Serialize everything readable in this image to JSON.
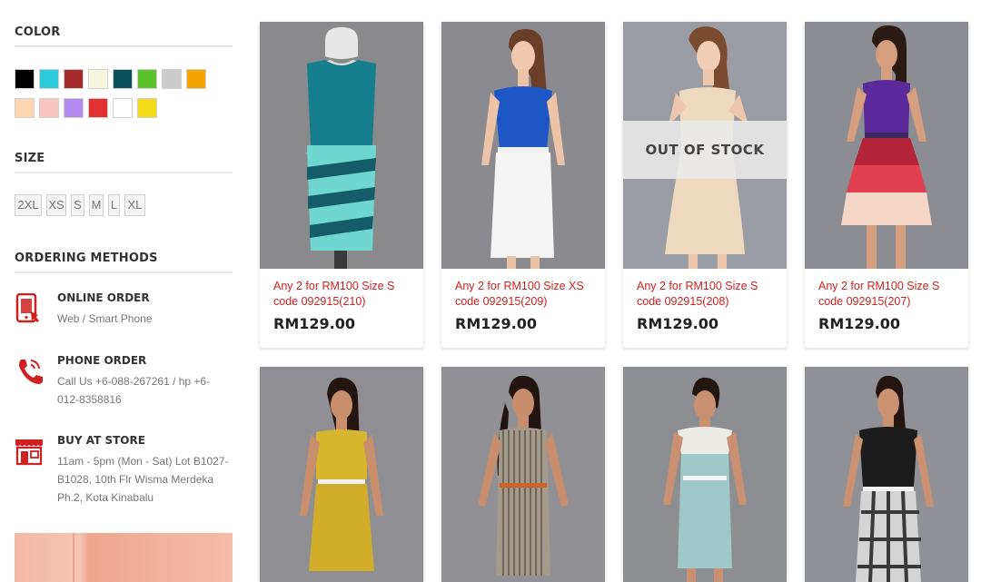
{
  "sidebar": {
    "color_title": "COLOR",
    "colors": [
      "#000000",
      "#2ecbdc",
      "#a52a2a",
      "#f5f5dc",
      "#0a4f5c",
      "#5cc12b",
      "#cccccc",
      "#f5a300",
      "#fdd5b1",
      "#f7c4c0",
      "#b58af0",
      "#e03030",
      "#ffffff",
      "#f5dc1a"
    ],
    "size_title": "SIZE",
    "sizes": [
      "2XL",
      "XS",
      "S",
      "M",
      "L",
      "XL"
    ],
    "ordering_title": "ORDERING METHODS",
    "ordering": [
      {
        "title": "ONLINE ORDER",
        "desc": "Web / Smart Phone",
        "icon": "smartphone-icon"
      },
      {
        "title": "PHONE ORDER",
        "desc": "Call Us +6-088-267261 / hp +6-012-8358816",
        "icon": "phone-icon"
      },
      {
        "title": "BUY AT STORE",
        "desc": "11am - 5pm (Mon - Sat) Lot B1027-B1028, 10th Flr Wisma Merdeka Ph.2, Kota Kinabalu",
        "icon": "store-icon"
      }
    ]
  },
  "products": [
    {
      "name": "Any 2 for RM100 Size S code 092915(210)",
      "price": "RM129.00"
    },
    {
      "name": "Any 2 for RM100 Size XS code 092915(209)",
      "price": "RM129.00"
    },
    {
      "name": "Any 2 for RM100 Size S code 092915(208)",
      "price": "RM129.00",
      "badge": "OUT OF STOCK"
    },
    {
      "name": "Any 2 for RM100 Size S code 092915(207)",
      "price": "RM129.00"
    },
    {},
    {},
    {},
    {}
  ],
  "theme": {
    "accent": "#d0201f",
    "price": "#222222"
  }
}
